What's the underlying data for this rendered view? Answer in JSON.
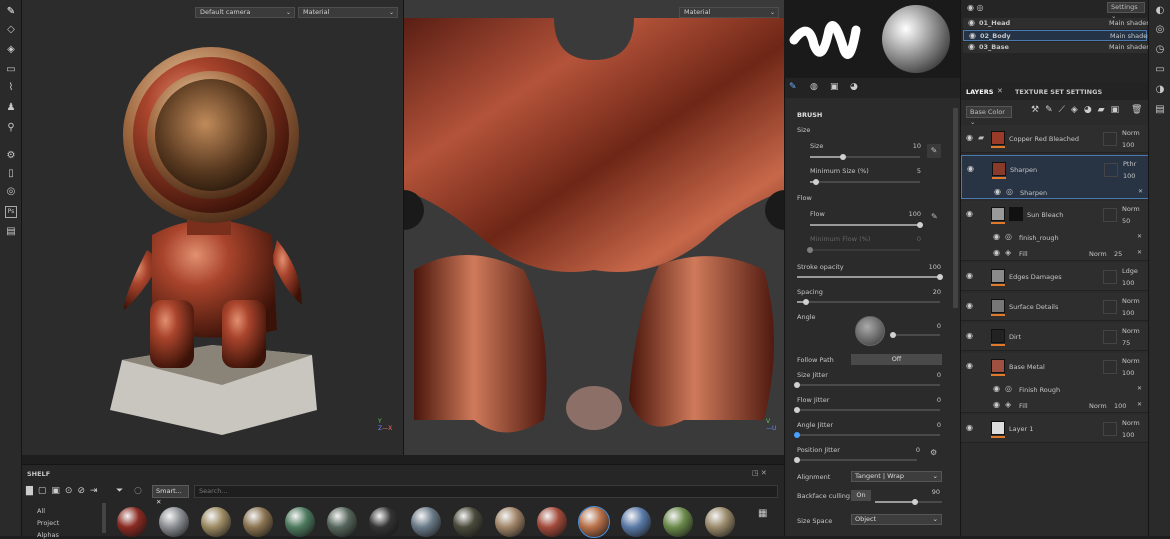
{
  "viewport3d": {
    "camera": "Default camera",
    "mode": "Material"
  },
  "viewport2d": {
    "mode": "Material"
  },
  "toolbar": {
    "icons": [
      "paint-brush-icon",
      "eraser-icon",
      "projection-icon",
      "polygon-fill-icon",
      "smudge-icon",
      "clone-icon",
      "color-picker-icon",
      "bake-icon",
      "geometry-mask-icon",
      "dot-icon",
      "photoshop-icon",
      "export-icon"
    ]
  },
  "shelf": {
    "title": "SHELF",
    "categories": [
      "All",
      "Project",
      "Alphas"
    ],
    "filter_chip": "Smart...",
    "search_placeholder": "Search...",
    "material_colors": [
      "#8a2a22",
      "#8a8d92",
      "#9c8a62",
      "#8a7350",
      "#4d7a5e",
      "#56665c",
      "#333333",
      "#6a7a88",
      "#4a4a3c",
      "#a08468",
      "#a24a3a",
      "#b87048",
      "#5a7aa8",
      "#6a8a4a",
      "#9a8a6a"
    ]
  },
  "texture_sets": {
    "settings_label": "Settings",
    "items": [
      {
        "name": "01_Head",
        "shader": "Main shader"
      },
      {
        "name": "02_Body",
        "shader": "Main shader"
      },
      {
        "name": "03_Base",
        "shader": "Main shader"
      }
    ]
  },
  "properties": {
    "section": "BRUSH",
    "size_group": "Size",
    "size": {
      "label": "Size",
      "value": "10",
      "fraction": 0.3
    },
    "min_size": {
      "label": "Minimum Size (%)",
      "value": "5",
      "fraction": 0.05
    },
    "flow_group": "Flow",
    "flow": {
      "label": "Flow",
      "value": "100",
      "fraction": 1.0
    },
    "min_flow": {
      "label": "Minimum Flow (%)",
      "value": "0",
      "fraction": 0.0
    },
    "stroke_opacity": {
      "label": "Stroke opacity",
      "value": "100",
      "fraction": 1.0
    },
    "spacing": {
      "label": "Spacing",
      "value": "20",
      "fraction": 0.06
    },
    "angle": {
      "label": "Angle",
      "value": "0",
      "fraction": 0.0
    },
    "follow_path": {
      "label": "Follow Path",
      "value": "Off"
    },
    "size_jitter": {
      "label": "Size Jitter",
      "value": "0",
      "fraction": 0.0
    },
    "flow_jitter": {
      "label": "Flow Jitter",
      "value": "0",
      "fraction": 0.0
    },
    "angle_jitter": {
      "label": "Angle Jitter",
      "value": "0",
      "fraction": 0.0
    },
    "position_jitter": {
      "label": "Position Jitter",
      "value": "0",
      "fraction": 0.0
    },
    "alignment": {
      "label": "Alignment",
      "value": "Tangent | Wrap"
    },
    "backface": {
      "label": "Backface culling",
      "toggle": "On",
      "value": "90",
      "fraction": 0.6
    },
    "size_space": {
      "label": "Size Space",
      "value": "Object"
    }
  },
  "layers_panel": {
    "tabs": [
      "LAYERS",
      "TEXTURE SET SETTINGS"
    ],
    "channel": "Base Color",
    "layers": [
      {
        "name": "Copper Red Bleached",
        "blend": "Norm",
        "opacity": "100",
        "thumb": "#9a3a28",
        "folder": true
      },
      {
        "name": "Sharpen",
        "blend": "Pthr",
        "opacity": "100",
        "thumb": "#8a3a2a",
        "selected": true,
        "effect": "Sharpen"
      },
      {
        "name": "Sun Bleach",
        "blend": "Norm",
        "opacity": "50",
        "thumb": "#9a9a9a",
        "mask": true,
        "effects": [
          "finish_rough"
        ],
        "fill": {
          "label": "Fill",
          "blend": "Norm",
          "opacity": "25"
        }
      },
      {
        "name": "Edges Damages",
        "blend": "Ldge",
        "opacity": "100",
        "thumb": "#8a8a8a"
      },
      {
        "name": "Surface Details",
        "blend": "Norm",
        "opacity": "100",
        "thumb": "#777777"
      },
      {
        "name": "Dirt",
        "blend": "Norm",
        "opacity": "75",
        "thumb": "#222222"
      },
      {
        "name": "Base Metal",
        "blend": "Norm",
        "opacity": "100",
        "thumb": "#a05040",
        "effects": [
          "Finish Rough"
        ],
        "fill": {
          "label": "Fill",
          "blend": "Norm",
          "opacity": "100"
        }
      },
      {
        "name": "Layer 1",
        "blend": "Norm",
        "opacity": "100",
        "thumb": "#dddddd"
      }
    ]
  }
}
